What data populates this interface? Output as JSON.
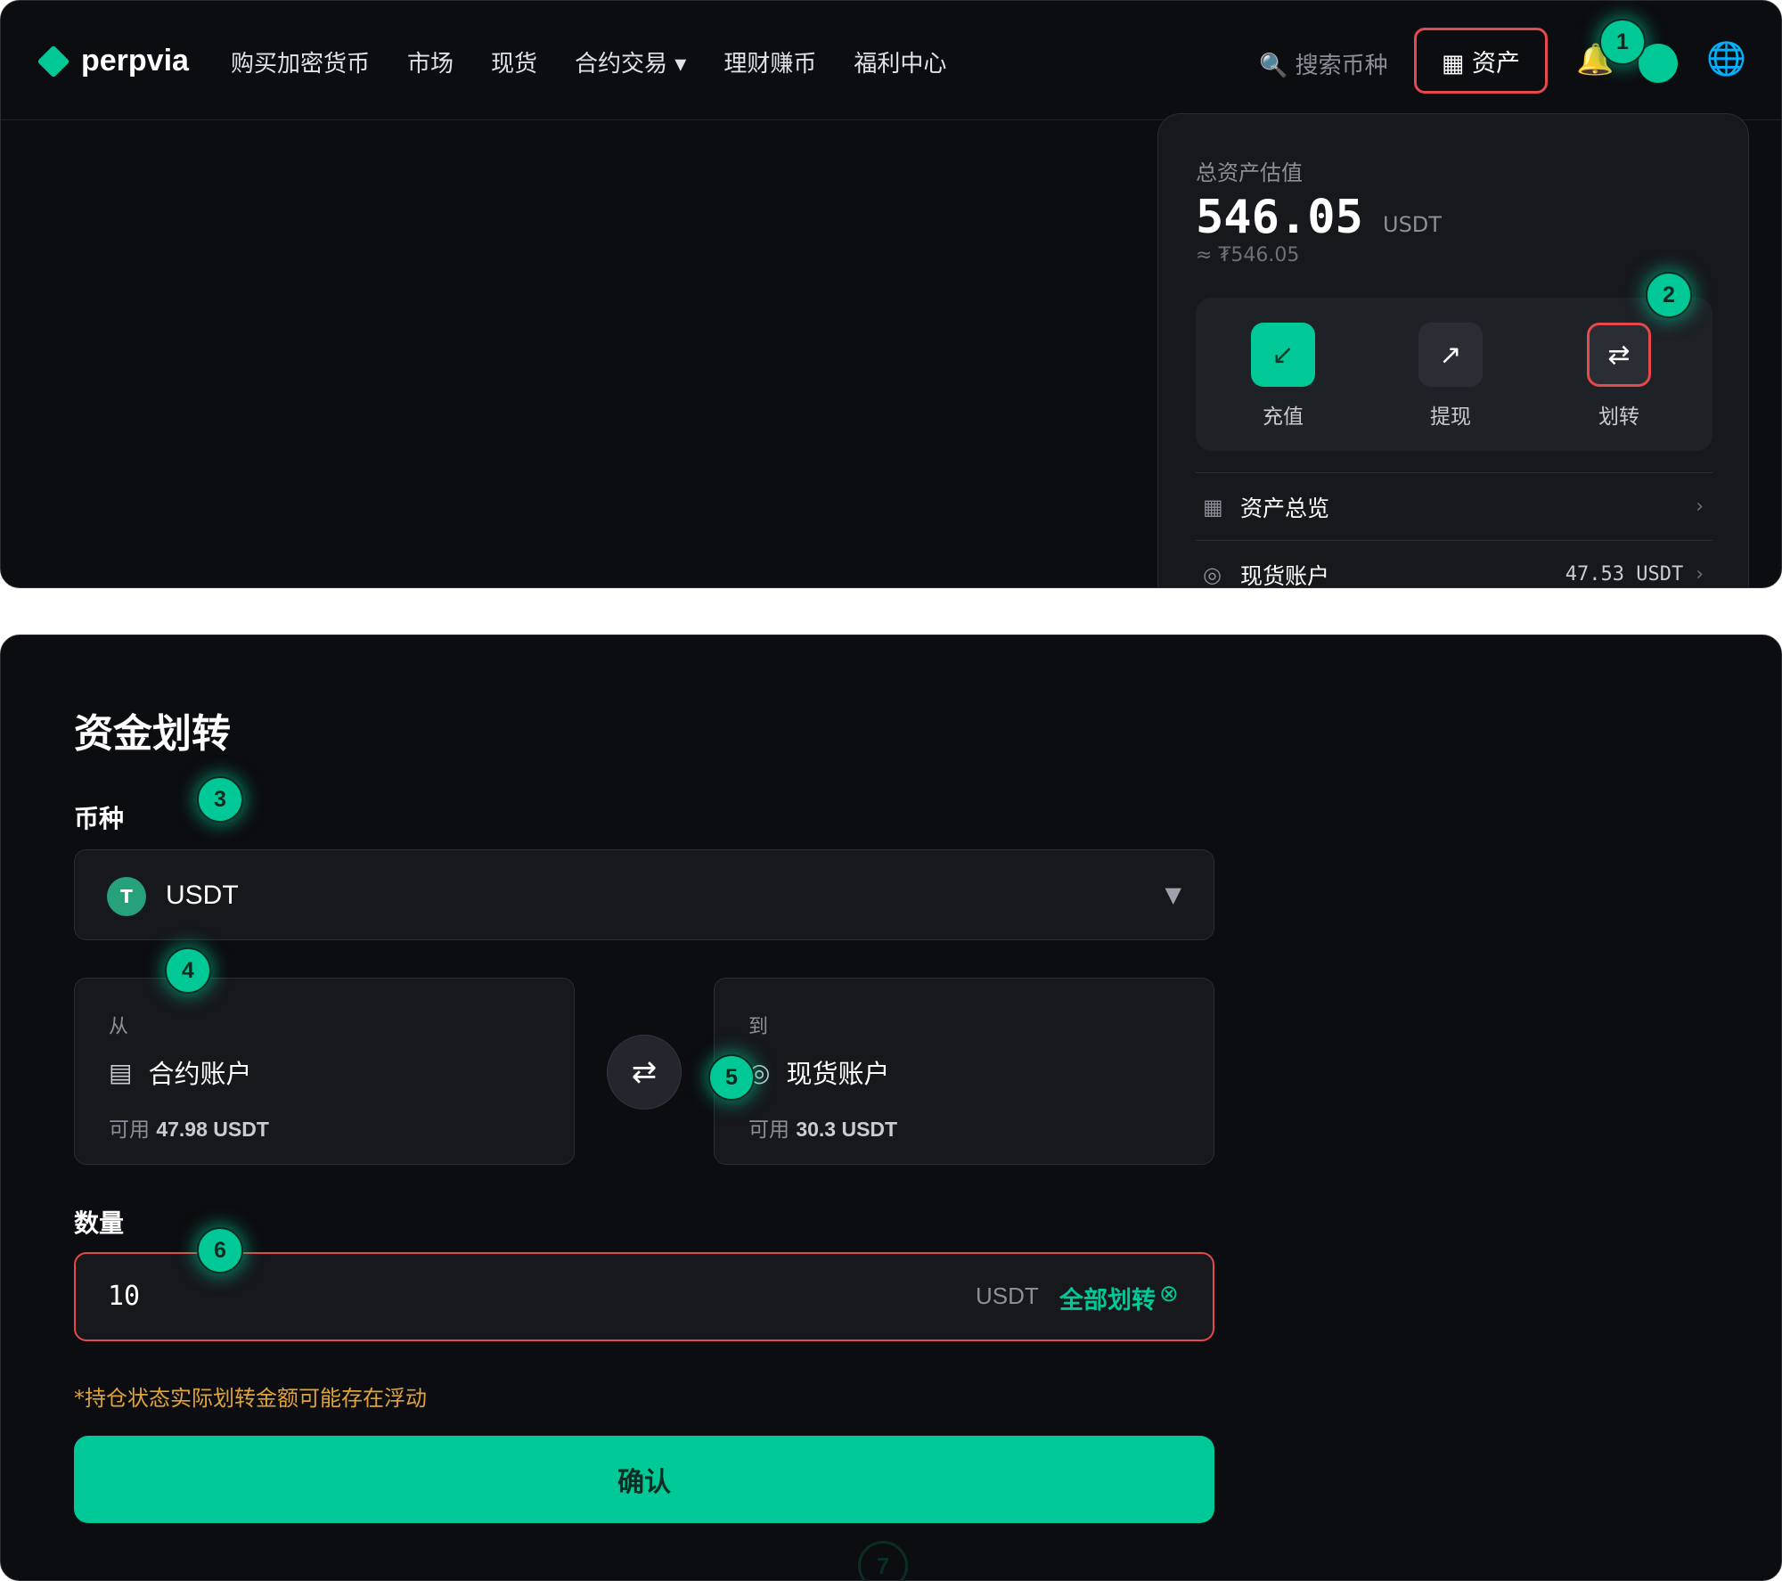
{
  "header": {
    "logo_text": "perpvia",
    "nav": [
      "购买加密货币",
      "市场",
      "现货",
      "合约交易 ▾",
      "理财赚币",
      "福利中心"
    ],
    "search_placeholder": "🔍 搜索币种",
    "assets_button": "▦ 资产"
  },
  "assets_dropdown": {
    "label": "总资产估值",
    "value": "546.05",
    "unit": "USDT",
    "approx": "≈ ₮546.05",
    "actions": [
      {
        "label": "充值",
        "icon": "deposit-arrow-icon",
        "glyph": "↙"
      },
      {
        "label": "提现",
        "icon": "withdraw-arrow-icon",
        "glyph": "↗"
      },
      {
        "label": "划转",
        "icon": "transfer-icon",
        "glyph": "⇄"
      }
    ],
    "rows": [
      {
        "label": "资产总览",
        "value": "",
        "icon": "grid-icon",
        "glyph": "▦",
        "chevron": "›"
      },
      {
        "label": "现货账户",
        "value": "47.53 USDT",
        "icon": "circle-icon",
        "glyph": "◎",
        "chevron": "›"
      }
    ]
  },
  "markers": [
    "1",
    "2",
    "3",
    "4",
    "5",
    "6",
    "7"
  ],
  "transfer": {
    "title": "资金划转",
    "coin_label": "币种",
    "coin": {
      "badge": "T",
      "value": "USDT",
      "caret": "▼"
    },
    "from": {
      "dir": "从",
      "name": "合约账户",
      "glyph": "▤",
      "avail_prefix": "可用",
      "avail_value": "47.98 USDT"
    },
    "to": {
      "dir": "到",
      "name": "现货账户",
      "glyph": "◎",
      "avail_prefix": "可用",
      "avail_value": "30.3 USDT"
    },
    "swap_glyph": "⇄",
    "amount_label": "数量",
    "amount": {
      "value": "10",
      "unit": "USDT",
      "all_label": "全部划转",
      "clear_glyph": "⊗"
    },
    "warning": "*持仓状态实际划转金额可能存在浮动",
    "confirm": "确认"
  },
  "colors": {
    "accent": "#00c897",
    "highlight": "#e5484d",
    "background": "#0c0d10",
    "warning": "#e0a33a"
  }
}
